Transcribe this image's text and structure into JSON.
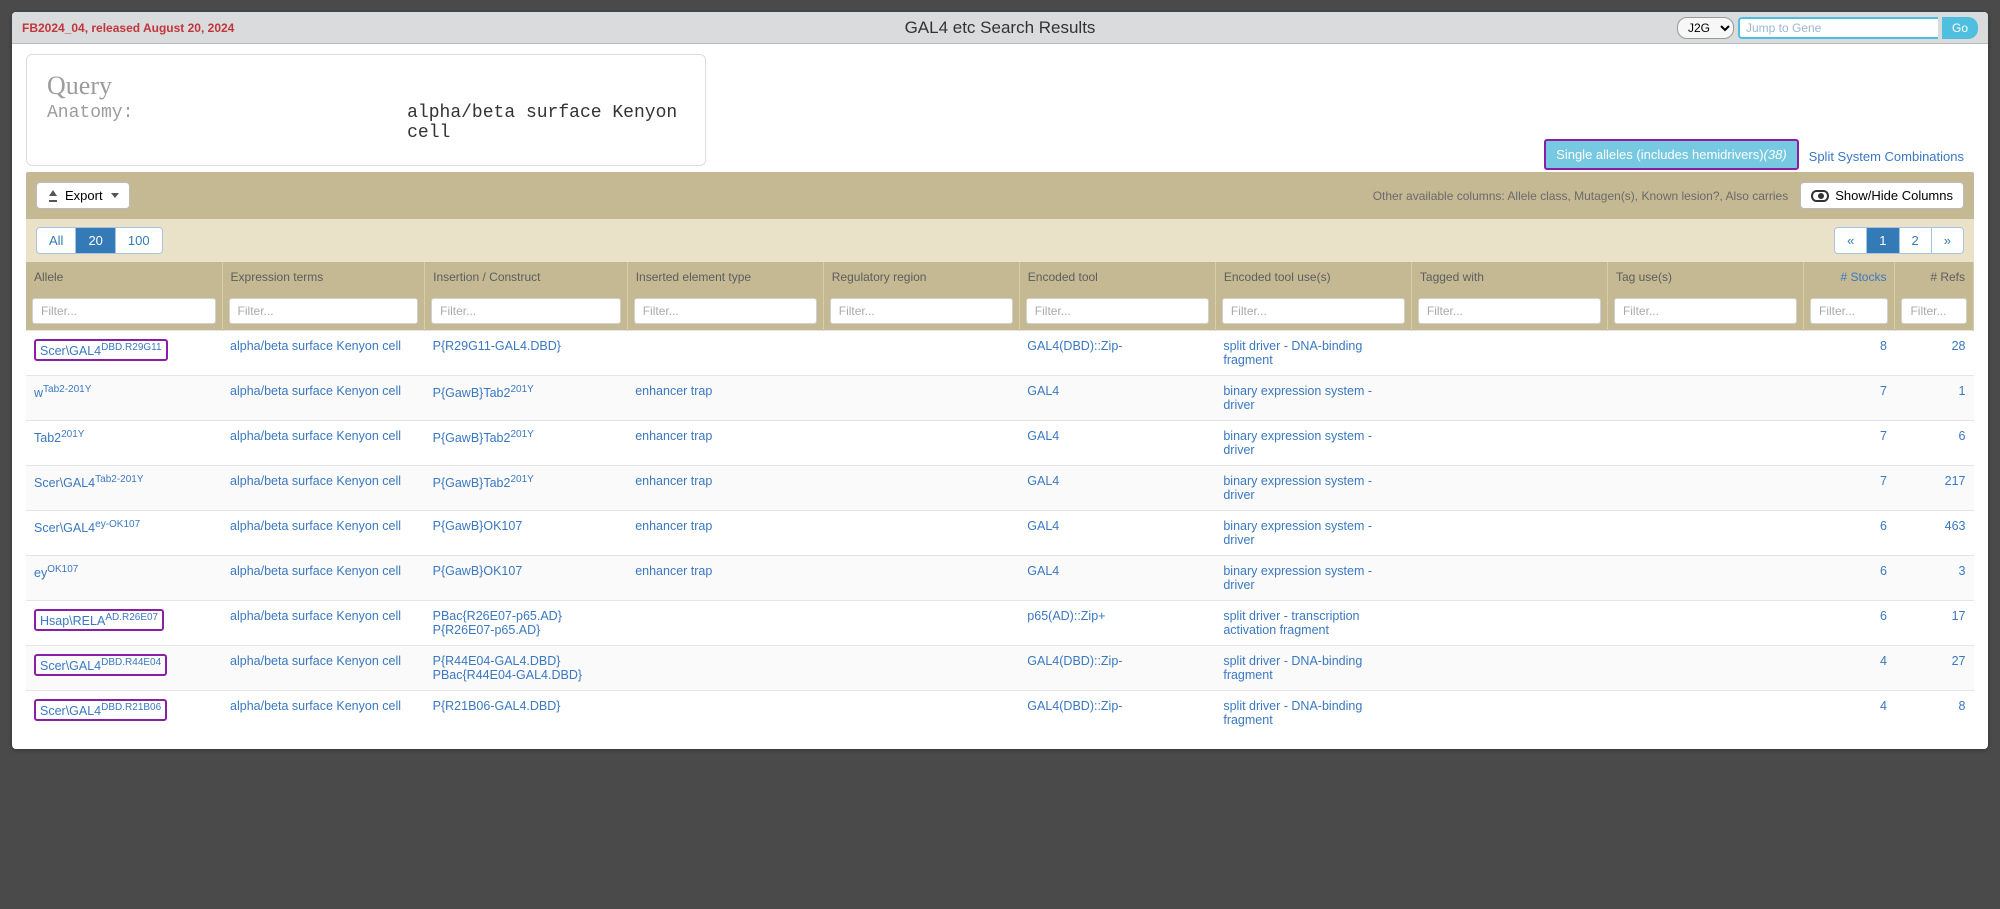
{
  "topbar": {
    "release": "FB2024_04, released August 20, 2024",
    "title": "GAL4 etc Search Results",
    "j2g_selected": "J2G",
    "j2g_placeholder": "Jump to Gene",
    "go_label": "Go"
  },
  "query": {
    "heading": "Query",
    "label": "Anatomy:",
    "value": "alpha/beta surface Kenyon cell"
  },
  "tabs": {
    "active_label": "Single alleles (includes hemidrivers)",
    "active_count": "(38)",
    "other_label": "Split System Combinations"
  },
  "toolbar": {
    "export_label": "Export",
    "avail_text": "Other available columns: Allele class, Mutagen(s), Known lesion?, Also carries",
    "showhide_label": "Show/Hide Columns"
  },
  "pager": {
    "sizes": [
      "All",
      "20",
      "100"
    ],
    "active_size": "20",
    "pages_left": "«",
    "page1": "1",
    "page2": "2",
    "pages_right": "»"
  },
  "columns": [
    "Allele",
    "Expression terms",
    "Insertion / Construct",
    "Inserted element type",
    "Regulatory region",
    "Encoded tool",
    "Encoded tool use(s)",
    "Tagged with",
    "Tag use(s)",
    "# Stocks",
    "# Refs"
  ],
  "filter_placeholder": "Filter...",
  "rows": [
    {
      "allele_main": "Scer\\GAL4",
      "allele_sup": "DBD.R29G11",
      "highlight": true,
      "expr": "alpha/beta surface Kenyon cell",
      "construct": "P{R29G11-GAL4.DBD}",
      "elem": "",
      "reg": "",
      "tool": "GAL4(DBD)::Zip-",
      "use": "split driver - DNA-binding fragment",
      "tagged": "",
      "taguse": "",
      "stocks": "8",
      "refs": "28"
    },
    {
      "allele_main": "w",
      "allele_sup": "Tab2-201Y",
      "highlight": false,
      "expr": "alpha/beta surface Kenyon cell",
      "construct": "P{GawB}Tab2",
      "construct_sup": "201Y",
      "elem": "enhancer trap",
      "reg": "",
      "tool": "GAL4",
      "use": "binary expression system - driver",
      "tagged": "",
      "taguse": "",
      "stocks": "7",
      "refs": "1"
    },
    {
      "allele_main": "Tab2",
      "allele_sup": "201Y",
      "highlight": false,
      "expr": "alpha/beta surface Kenyon cell",
      "construct": "P{GawB}Tab2",
      "construct_sup": "201Y",
      "elem": "enhancer trap",
      "reg": "",
      "tool": "GAL4",
      "use": "binary expression system - driver",
      "tagged": "",
      "taguse": "",
      "stocks": "7",
      "refs": "6"
    },
    {
      "allele_main": "Scer\\GAL4",
      "allele_sup": "Tab2-201Y",
      "highlight": false,
      "expr": "alpha/beta surface Kenyon cell",
      "construct": "P{GawB}Tab2",
      "construct_sup": "201Y",
      "elem": "enhancer trap",
      "reg": "",
      "tool": "GAL4",
      "use": "binary expression system - driver",
      "tagged": "",
      "taguse": "",
      "stocks": "7",
      "refs": "217"
    },
    {
      "allele_main": "Scer\\GAL4",
      "allele_sup": "ey-OK107",
      "highlight": false,
      "expr": "alpha/beta surface Kenyon cell",
      "construct": "P{GawB}OK107",
      "elem": "enhancer trap",
      "reg": "",
      "tool": "GAL4",
      "use": "binary expression system - driver",
      "tagged": "",
      "taguse": "",
      "stocks": "6",
      "refs": "463"
    },
    {
      "allele_main": "ey",
      "allele_sup": "OK107",
      "highlight": false,
      "expr": "alpha/beta surface Kenyon cell",
      "construct": "P{GawB}OK107",
      "elem": "enhancer trap",
      "reg": "",
      "tool": "GAL4",
      "use": "binary expression system - driver",
      "tagged": "",
      "taguse": "",
      "stocks": "6",
      "refs": "3"
    },
    {
      "allele_main": "Hsap\\RELA",
      "allele_sup": "AD.R26E07",
      "highlight": true,
      "expr": "alpha/beta surface Kenyon cell",
      "construct": "PBac{R26E07-p65.AD}\nP{R26E07-p65.AD}",
      "elem": "",
      "reg": "",
      "tool": "p65(AD)::Zip+",
      "use": "split driver - transcription activation fragment",
      "tagged": "",
      "taguse": "",
      "stocks": "6",
      "refs": "17"
    },
    {
      "allele_main": "Scer\\GAL4",
      "allele_sup": "DBD.R44E04",
      "highlight": true,
      "expr": "alpha/beta surface Kenyon cell",
      "construct": "P{R44E04-GAL4.DBD}\nPBac{R44E04-GAL4.DBD}",
      "elem": "",
      "reg": "",
      "tool": "GAL4(DBD)::Zip-",
      "use": "split driver - DNA-binding fragment",
      "tagged": "",
      "taguse": "",
      "stocks": "4",
      "refs": "27"
    },
    {
      "allele_main": "Scer\\GAL4",
      "allele_sup": "DBD.R21B06",
      "highlight": true,
      "expr": "alpha/beta surface Kenyon cell",
      "construct": "P{R21B06-GAL4.DBD}",
      "elem": "",
      "reg": "",
      "tool": "GAL4(DBD)::Zip-",
      "use": "split driver - DNA-binding fragment",
      "tagged": "",
      "taguse": "",
      "stocks": "4",
      "refs": "8"
    }
  ]
}
